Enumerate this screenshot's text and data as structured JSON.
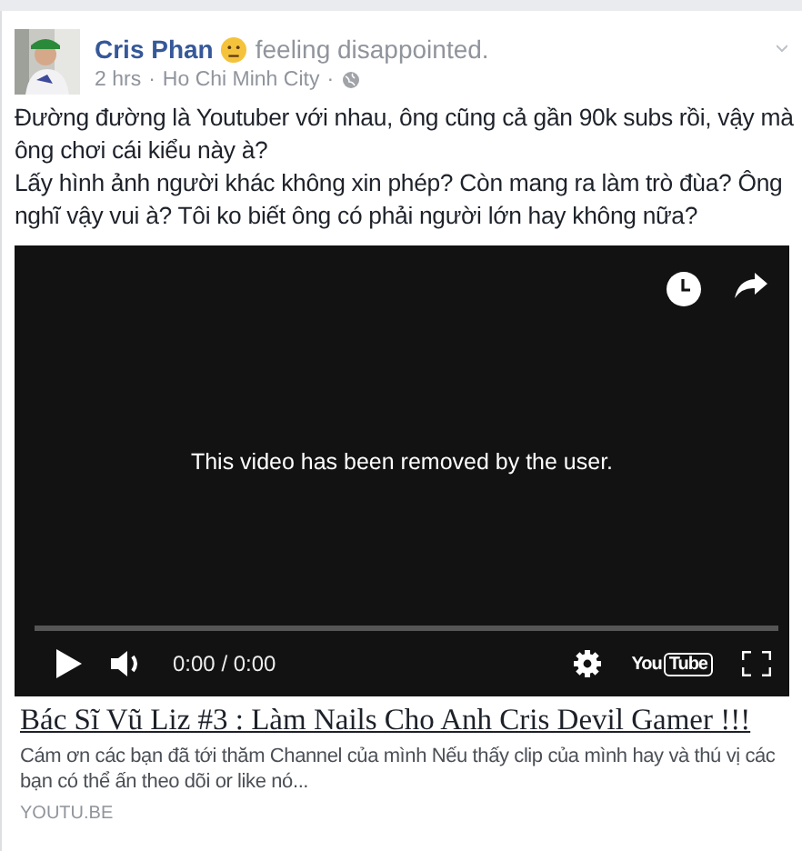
{
  "post": {
    "author": "Cris Phan",
    "feeling": "feeling disappointed.",
    "time": "2 hrs",
    "separator": "·",
    "location": "Ho Chi Minh City",
    "separator_2": "·",
    "paragraphs": [
      "Đường đường là Youtuber với nhau, ông cũng cả gần 90k subs rồi, vậy mà ông chơi cái kiểu này à?",
      "Lấy hình ảnh người khác không xin phép? Còn mang ra làm trò đùa? Ông nghĩ vậy vui à? Tôi ko biết ông có phải người lớn hay không nữa?"
    ]
  },
  "video": {
    "message": "This video has been removed by the user.",
    "time": "0:00 / 0:00",
    "youtube_logo": {
      "left": "You",
      "right": "Tube"
    }
  },
  "link": {
    "title": "Bác Sĩ Vũ Liz #3 : Làm Nails Cho Anh Cris Devil Gamer !!!",
    "description": "Cám ơn các bạn đã tới thăm Channel của mình Nếu thấy clip của mình hay và thú vị các bạn có thể ấn theo dõi or like nó...",
    "domain": "YOUTU.BE"
  }
}
